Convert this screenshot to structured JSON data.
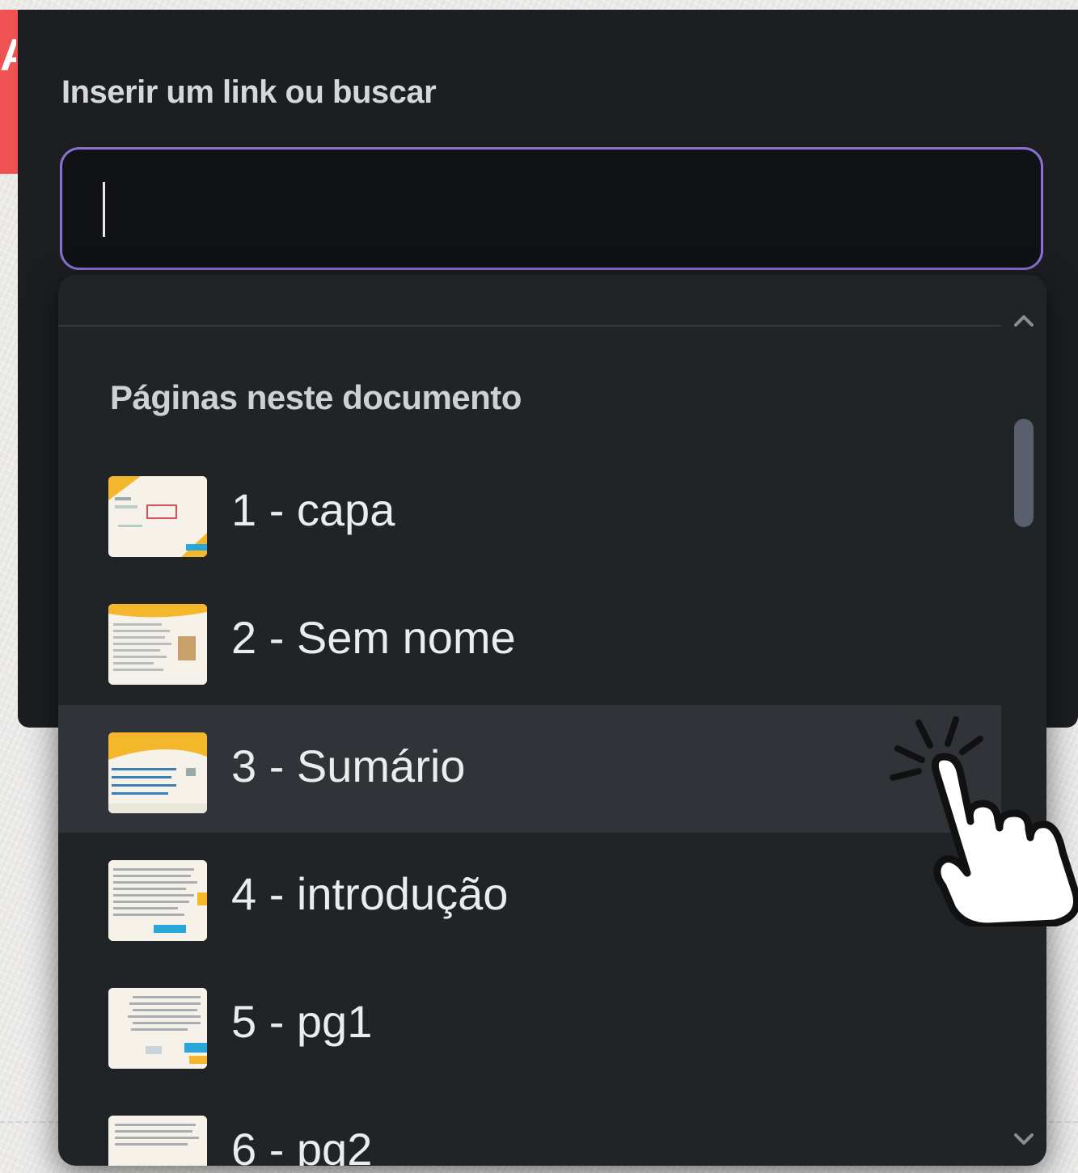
{
  "banner": {
    "letter": "A"
  },
  "link_panel": {
    "label": "Inserir um link ou buscar",
    "search": {
      "value": "",
      "placeholder": ""
    }
  },
  "dropdown": {
    "section_title": "Páginas neste documento",
    "highlighted_index": 2,
    "items": [
      {
        "label": "1 - capa",
        "thumb_icon": "page-thumbnail"
      },
      {
        "label": "2 - Sem nome",
        "thumb_icon": "page-thumbnail"
      },
      {
        "label": "3 - Sumário",
        "thumb_icon": "page-thumbnail"
      },
      {
        "label": "4 - introdução",
        "thumb_icon": "page-thumbnail"
      },
      {
        "label": "5 - pg1",
        "thumb_icon": "page-thumbnail"
      },
      {
        "label": "6 - pg2",
        "thumb_icon": "page-thumbnail"
      }
    ]
  },
  "colors": {
    "banner_red": "#f05252",
    "panel_bg": "#1c1e21",
    "input_border": "#8b6fd3",
    "highlight_row": "#303337",
    "scroll_thumb": "#5a5f6e"
  }
}
